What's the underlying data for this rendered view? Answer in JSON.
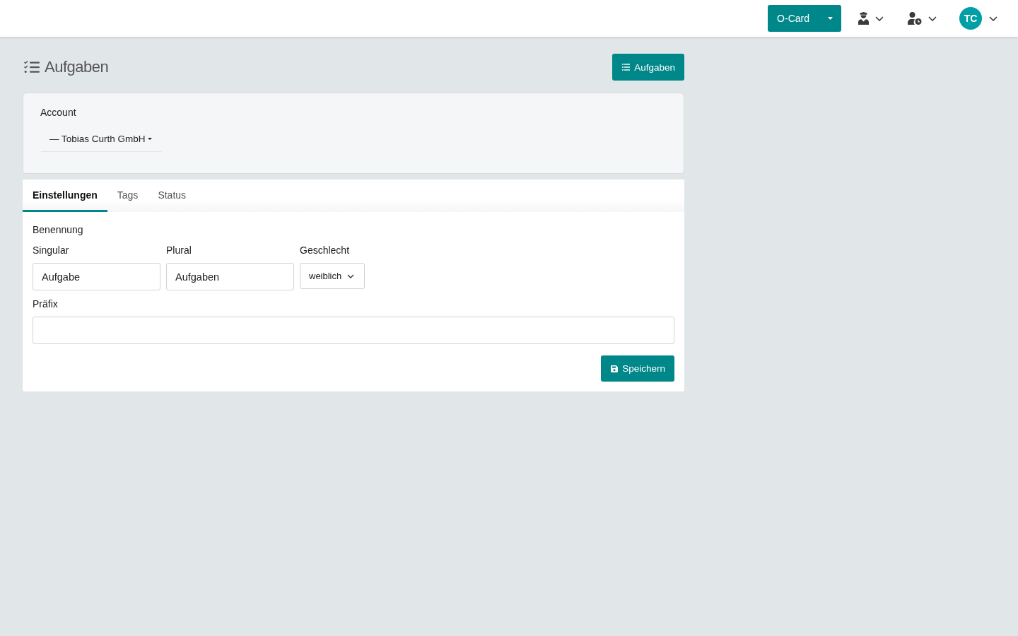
{
  "navbar": {
    "product_button": {
      "label": "O-Card"
    },
    "avatar": {
      "initials": "TC"
    }
  },
  "header": {
    "title": "Aufgaben",
    "button": "Aufgaben"
  },
  "account": {
    "label": "Account",
    "selected_value": "— Tobias Curth GmbH"
  },
  "tabs": [
    {
      "label": "Einstellungen",
      "selected": true
    },
    {
      "label": "Tags",
      "selected": false
    },
    {
      "label": "Status",
      "selected": false
    }
  ],
  "form": {
    "section": "Benennung",
    "fields": [
      {
        "kind": "text",
        "label": "Singular",
        "value": "Aufgabe"
      },
      {
        "kind": "text",
        "label": "Plural",
        "value": "Aufgaben"
      },
      {
        "kind": "select",
        "label": "Geschlecht",
        "value": "weiblich"
      }
    ],
    "prefix": {
      "label": "Präfix"
    },
    "save_button": "Speichern"
  }
}
